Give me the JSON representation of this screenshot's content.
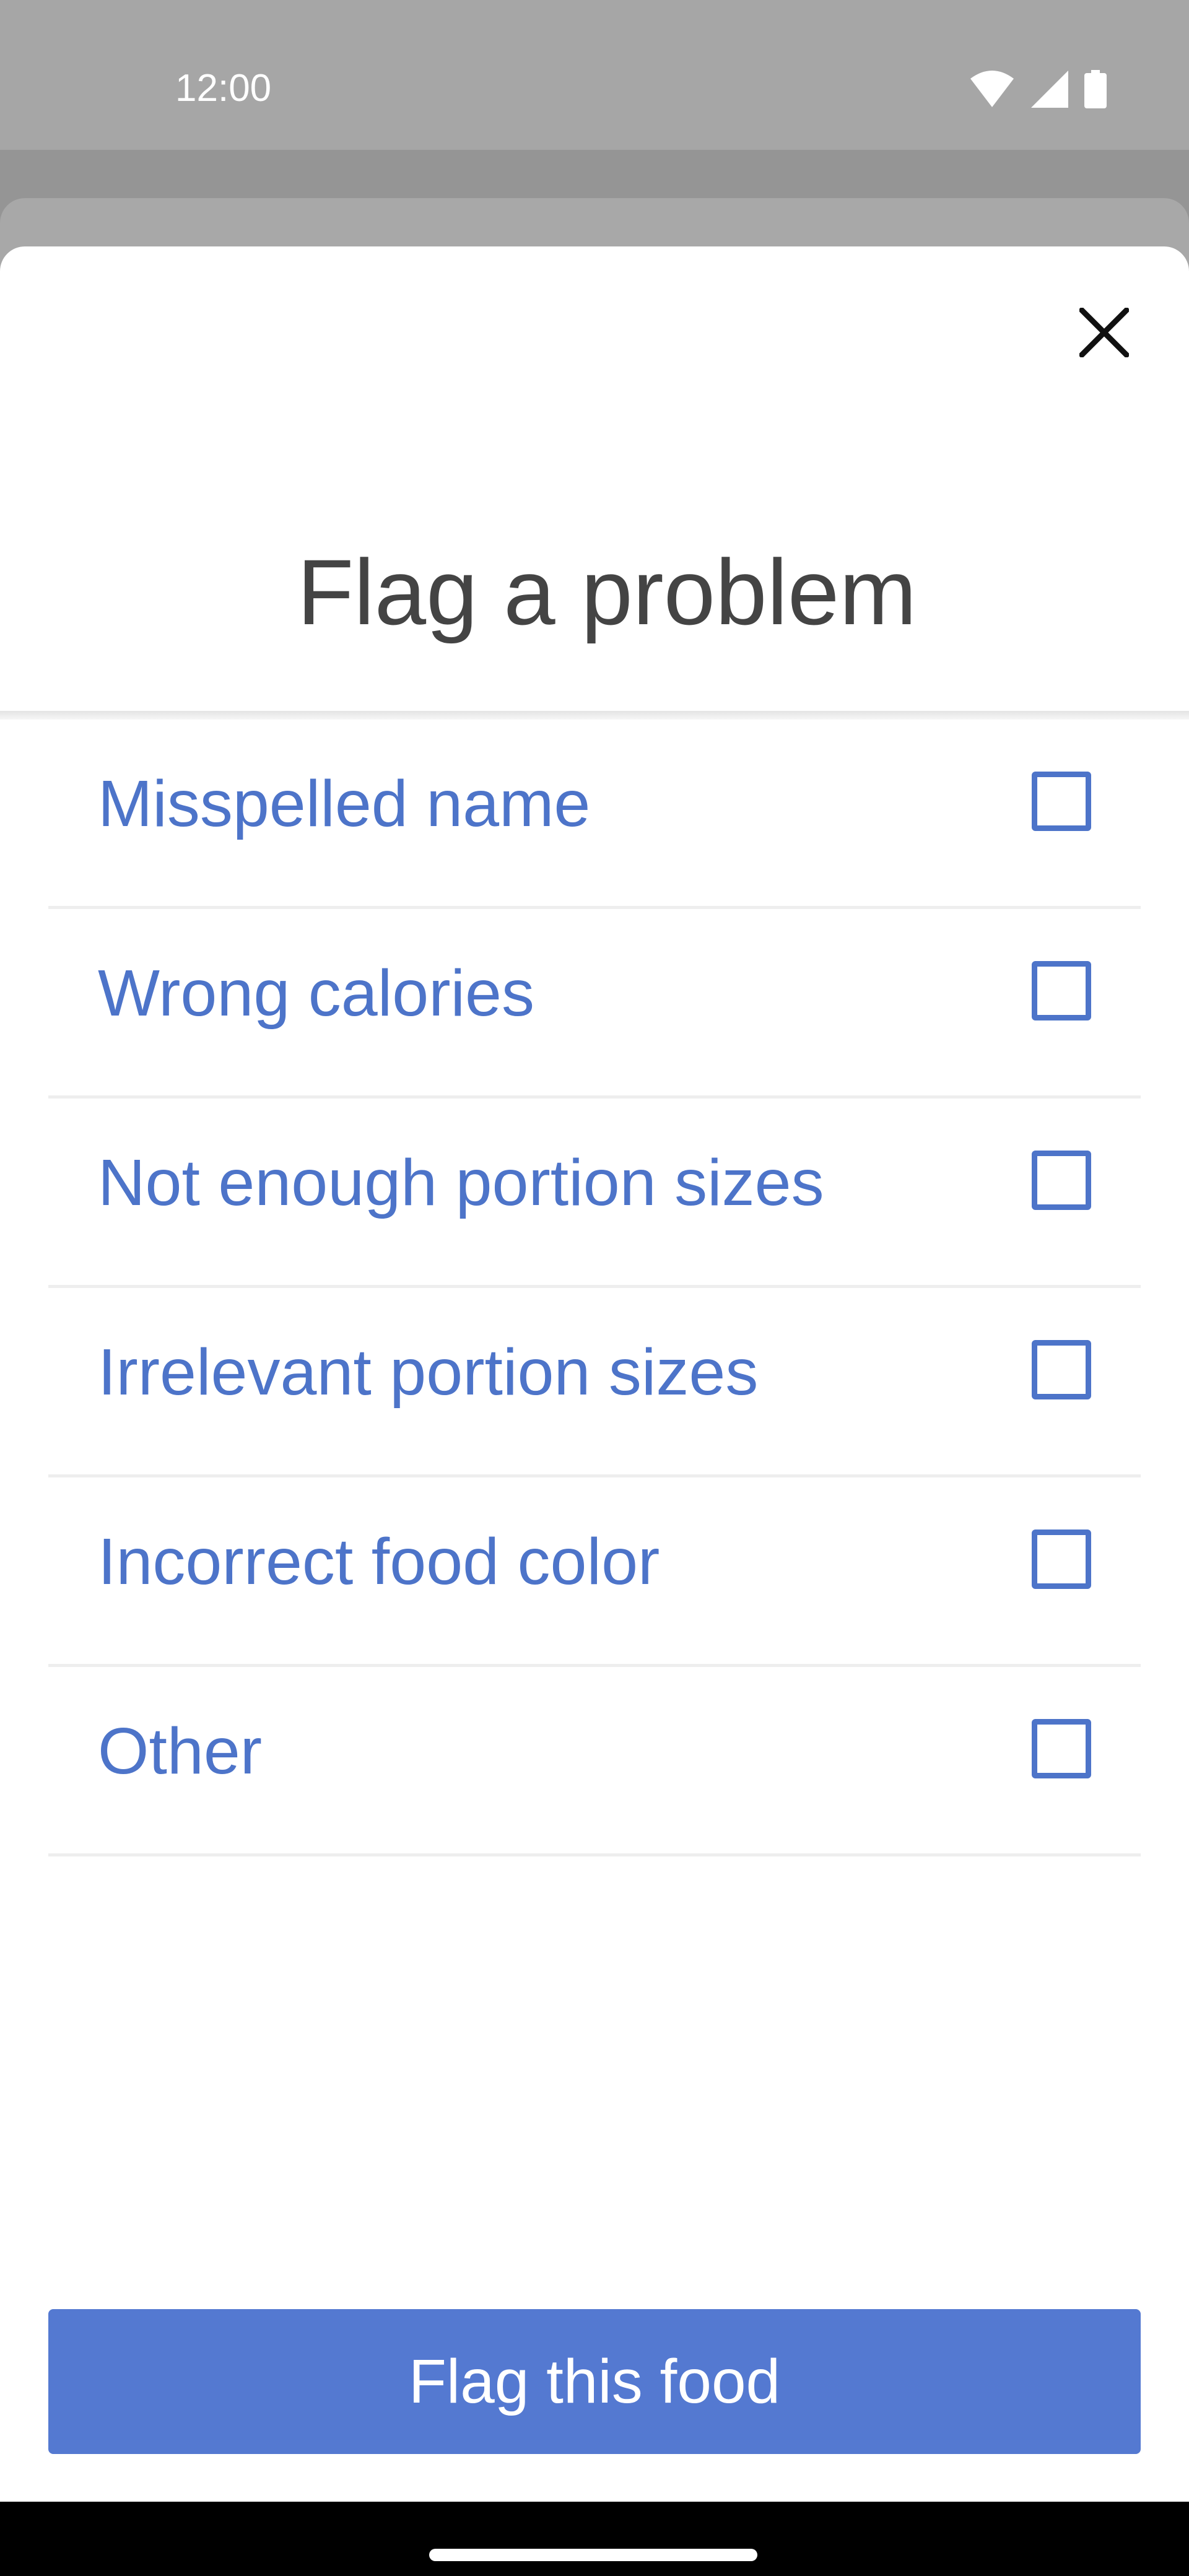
{
  "status_bar": {
    "time": "12:00",
    "icons": [
      "wifi-icon",
      "cellular-signal-icon",
      "battery-icon"
    ]
  },
  "sheet": {
    "close_icon": "close-icon",
    "title": "Flag a problem",
    "options": [
      {
        "label": "Misspelled name",
        "checked": false
      },
      {
        "label": "Wrong calories",
        "checked": false
      },
      {
        "label": "Not enough portion sizes",
        "checked": false
      },
      {
        "label": "Irrelevant portion sizes",
        "checked": false
      },
      {
        "label": "Incorrect food color",
        "checked": false
      },
      {
        "label": "Other",
        "checked": false
      }
    ],
    "submit_label": "Flag this food"
  },
  "colors": {
    "accent": "#5479d1",
    "option_text": "#4d74c9",
    "title_text": "#444444",
    "scrim": "#959595",
    "status_bar": "#a6a6a6",
    "nav_bar": "#000000"
  }
}
